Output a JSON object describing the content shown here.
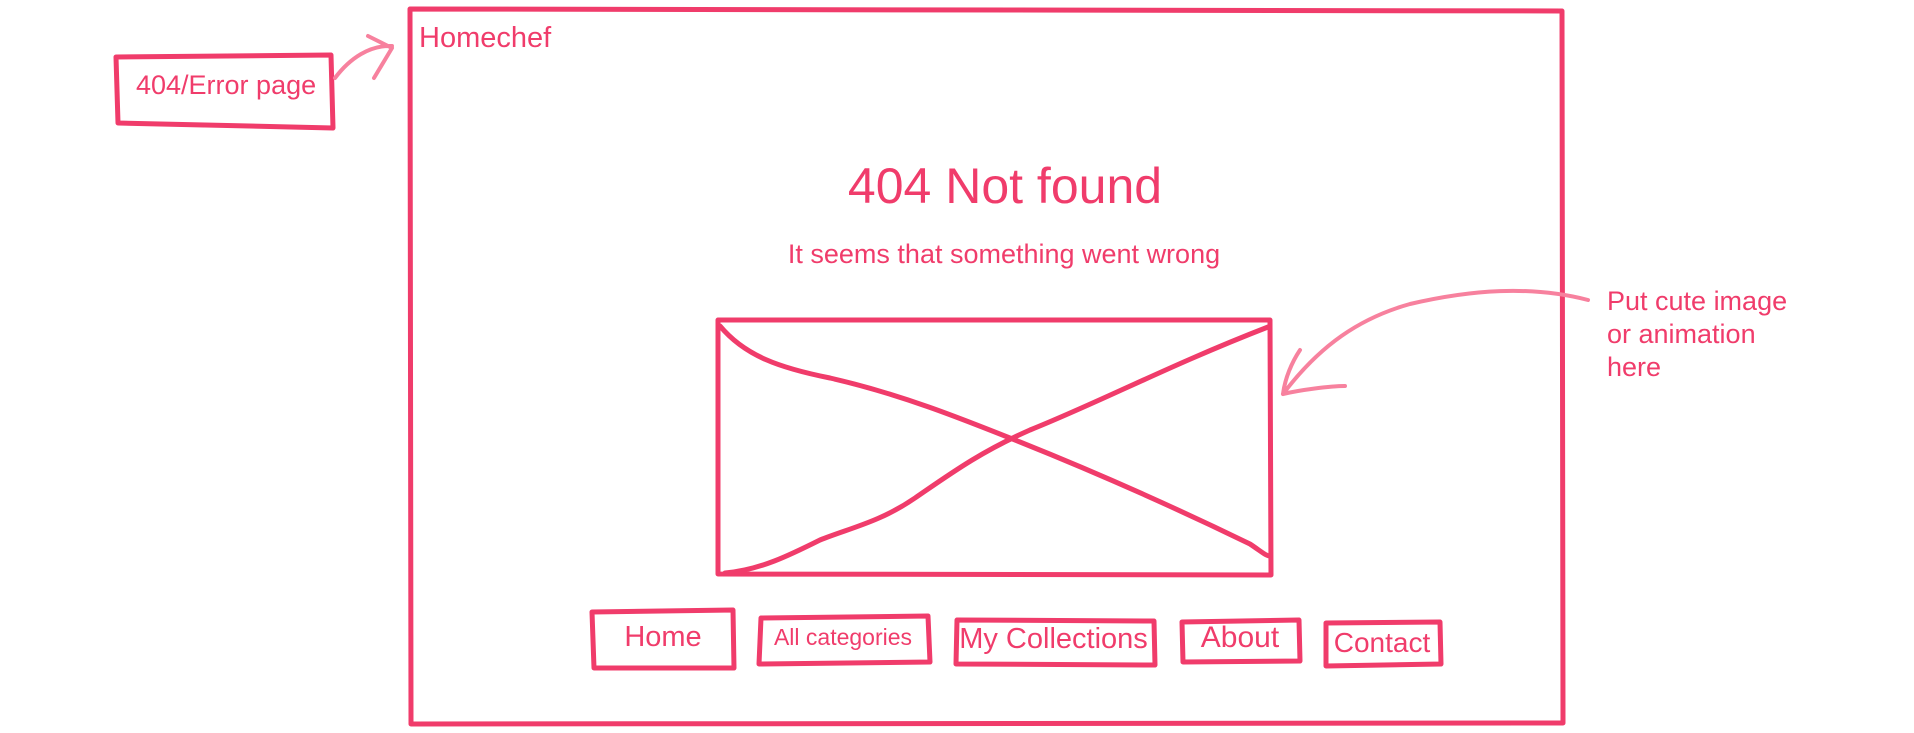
{
  "annotations": {
    "page_label": "404/Error page",
    "image_note": [
      "Put cute image",
      "or animation",
      "here"
    ]
  },
  "page": {
    "brand": "Homechef",
    "headline": "404 Not found",
    "message": "It seems that something went wrong",
    "image_placeholder_icon": "image-placeholder-cross"
  },
  "nav": {
    "home": "Home",
    "all_categories": "All categories",
    "my_collections": "My Collections",
    "about": "About",
    "contact": "Contact"
  },
  "colors": {
    "stroke": "#f03c6b",
    "stroke_light": "#f7819e"
  }
}
